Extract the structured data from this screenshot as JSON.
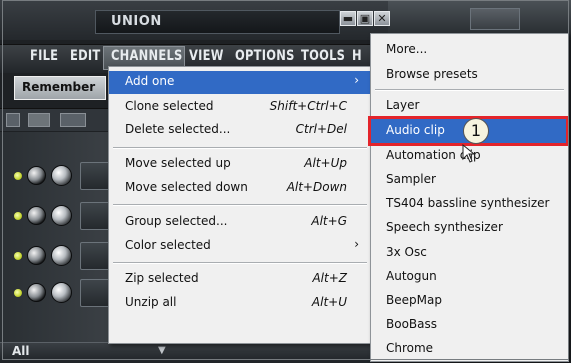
{
  "app": {
    "title": "UNION",
    "window_buttons": [
      "▬",
      "▣",
      "✕"
    ]
  },
  "menubar": {
    "items": [
      "FILE",
      "EDIT",
      "CHANNELS",
      "VIEW",
      "OPTIONS",
      "TOOLS",
      "H"
    ]
  },
  "toolbar": {
    "preset_value": "Remember"
  },
  "status": {
    "filter_value": "All"
  },
  "context_menu": {
    "items": [
      {
        "label": "Add one",
        "shortcut": "",
        "submenu": true,
        "highlighted": true
      },
      {
        "label": "Clone selected",
        "shortcut": "Shift+Ctrl+C"
      },
      {
        "label": "Delete selected...",
        "shortcut": "Ctrl+Del"
      },
      {
        "label": "Move selected up",
        "shortcut": "Alt+Up"
      },
      {
        "label": "Move selected down",
        "shortcut": "Alt+Down"
      },
      {
        "label": "Group selected...",
        "shortcut": "Alt+G"
      },
      {
        "label": "Color selected",
        "shortcut": "",
        "submenu": true
      },
      {
        "label": "Zip selected",
        "shortcut": "Alt+Z"
      },
      {
        "label": "Unzip all",
        "shortcut": "Alt+U"
      }
    ],
    "submenu_arrow": "›"
  },
  "submenu": {
    "items": [
      {
        "label": "More..."
      },
      {
        "label": "Browse presets"
      },
      {
        "label": "Layer"
      },
      {
        "label": "Audio clip",
        "highlighted": true
      },
      {
        "label": "Automation clip"
      },
      {
        "label": "Sampler"
      },
      {
        "label": "TS404 bassline synthesizer"
      },
      {
        "label": "Speech synthesizer"
      },
      {
        "label": "3x Osc"
      },
      {
        "label": "Autogun"
      },
      {
        "label": "BeepMap"
      },
      {
        "label": "BooBass"
      },
      {
        "label": "Chrome"
      }
    ]
  },
  "callout": {
    "number": "1"
  },
  "colors": {
    "highlight": "#316ac5",
    "callout_border": "#e3242b"
  },
  "icons": [
    "minimize-icon",
    "restore-icon",
    "close-icon",
    "chevron-right-icon",
    "mouse-cursor-icon"
  ]
}
